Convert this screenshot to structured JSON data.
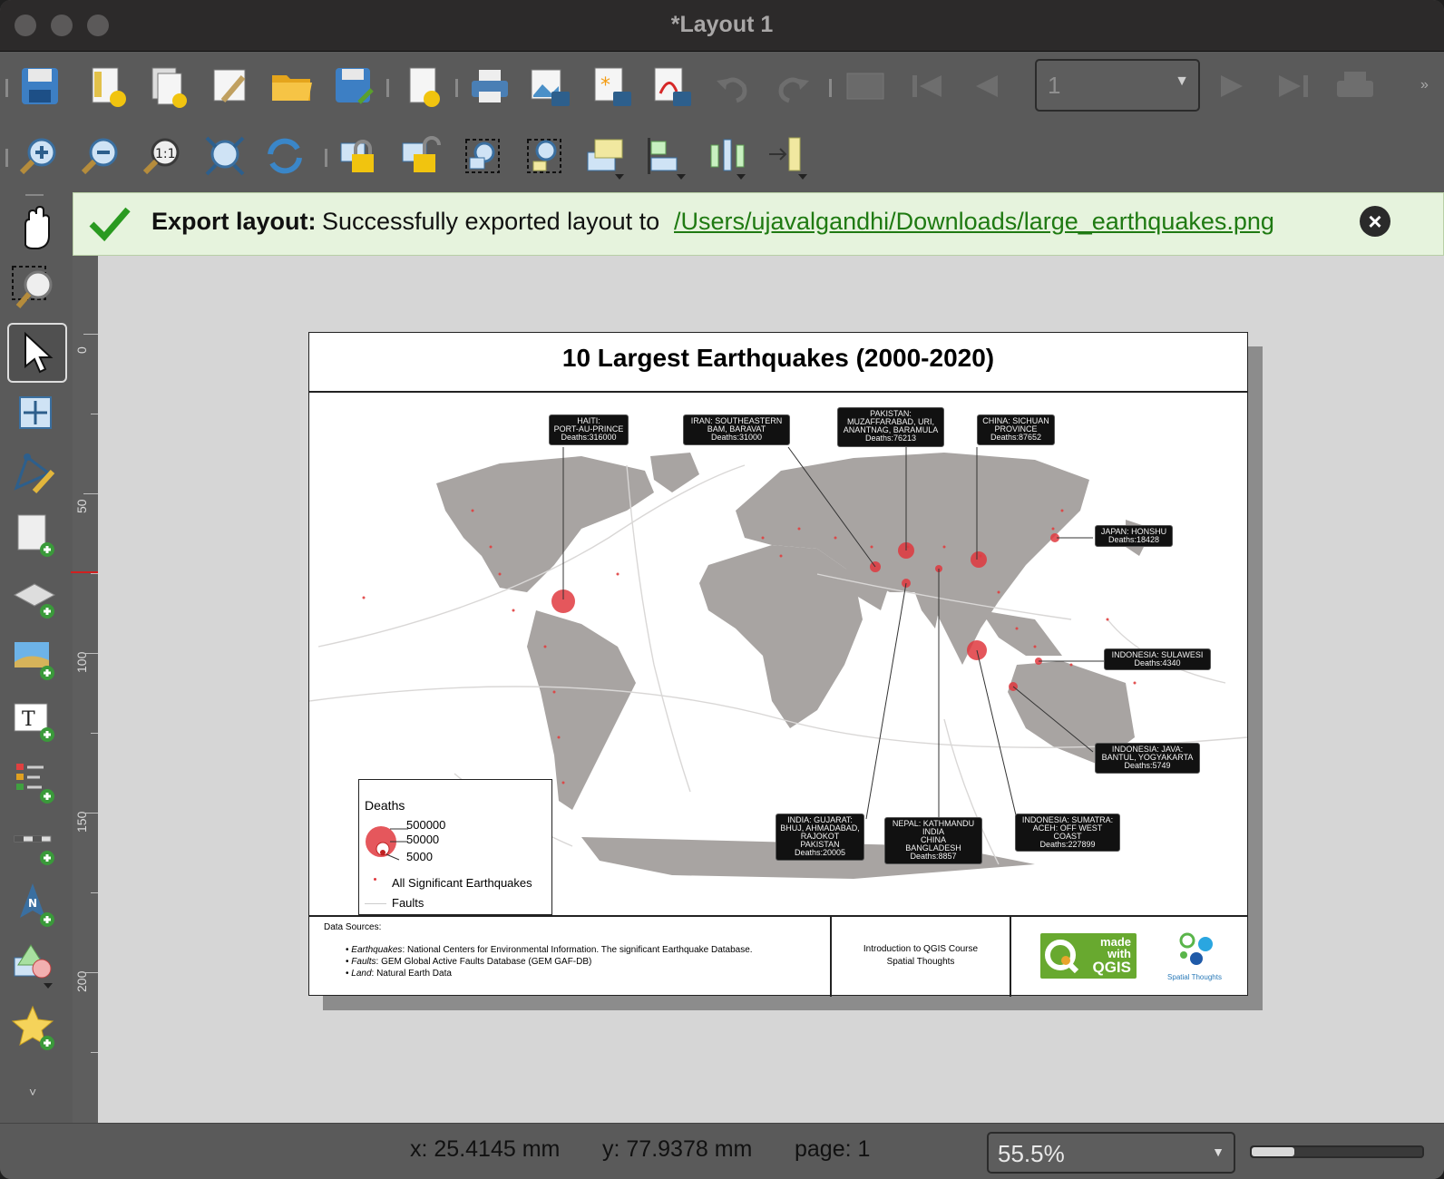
{
  "window": {
    "title": "*Layout 1"
  },
  "toolbar": {
    "row1_icons": [
      "save-icon",
      "new-layout-icon",
      "duplicate-layout-icon",
      "layout-manager-icon",
      "open-folder-icon",
      "save-as-template-icon",
      "add-page-icon",
      "print-icon",
      "export-image-icon",
      "export-svg-icon",
      "export-pdf-icon",
      "undo-icon",
      "redo-icon",
      "atlas-preview-icon",
      "first-feature-icon",
      "previous-feature-icon",
      "next-feature-icon",
      "last-feature-icon",
      "atlas-print-icon"
    ],
    "page_select": {
      "value": "1"
    },
    "row2_icons": [
      "zoom-in-icon",
      "zoom-out-icon",
      "zoom-100-icon",
      "zoom-full-icon",
      "refresh-icon",
      "lock-items-icon",
      "unlock-items-icon",
      "group-items-icon",
      "ungroup-items-icon",
      "raise-items-icon",
      "align-items-icon",
      "distribute-items-icon",
      "resize-items-icon"
    ]
  },
  "left_tools": [
    "pan-icon",
    "zoom-tool-icon",
    "select-move-icon",
    "move-content-icon",
    "edit-nodes-icon",
    "add-map-icon",
    "add-3d-map-icon",
    "add-picture-icon",
    "add-label-icon",
    "add-legend-icon",
    "add-scalebar-icon",
    "add-north-arrow-icon",
    "add-shape-icon",
    "add-marker-icon"
  ],
  "message": {
    "title": "Export layout:",
    "text": "Successfully exported layout to",
    "link": "/Users/ujavalgandhi/Downloads/large_earthquakes.png",
    "color": "#1f7a12"
  },
  "ruler": {
    "labels": [
      "0",
      "50",
      "100",
      "150",
      "200"
    ]
  },
  "layout": {
    "map_title": "10 Largest Earthquakes (2000-2020)",
    "callouts": [
      {
        "id": "haiti",
        "lines": [
          "HAITI:",
          "PORT-AU-PRINCE",
          "Deaths:316000"
        ]
      },
      {
        "id": "iran",
        "lines": [
          "IRAN: SOUTHEASTERN",
          "BAM, BARAVAT",
          "Deaths:31000"
        ]
      },
      {
        "id": "pakistan",
        "lines": [
          "PAKISTAN:",
          "MUZAFFARABAD, URI,",
          "ANANTNAG, BARAMULA",
          "Deaths:76213"
        ]
      },
      {
        "id": "china",
        "lines": [
          "CHINA: SICHUAN",
          "PROVINCE",
          "Deaths:87652"
        ]
      },
      {
        "id": "japan",
        "lines": [
          "JAPAN: HONSHU",
          "Deaths:18428"
        ]
      },
      {
        "id": "sulawesi",
        "lines": [
          "INDONESIA: SULAWESI",
          "Deaths:4340"
        ]
      },
      {
        "id": "java",
        "lines": [
          "INDONESIA: JAVA:",
          "BANTUL, YOGYAKARTA",
          "Deaths:5749"
        ]
      },
      {
        "id": "india",
        "lines": [
          "INDIA: GUJARAT:",
          "BHUJ, AHMADABAD,",
          "RAJOKOT",
          "PAKISTAN",
          "Deaths:20005"
        ]
      },
      {
        "id": "nepal",
        "lines": [
          "NEPAL: KATHMANDU",
          "INDIA",
          "CHINA",
          "BANGLADESH",
          "Deaths:8857"
        ]
      },
      {
        "id": "sumatra",
        "lines": [
          "INDONESIA: SUMATRA:",
          "ACEH: OFF WEST",
          "COAST",
          "Deaths:227899"
        ]
      }
    ],
    "legend": {
      "title": "Deaths",
      "sizes": [
        "500000",
        "50000",
        "5000"
      ],
      "points_label": "All Significant Earthquakes",
      "faults_label": "Faults"
    },
    "footer": {
      "sources_title": "Data Sources:",
      "sources": [
        {
          "name": "Earthquakes",
          "text": ": National Centers for Environmental Information. The significant Earthquake Database."
        },
        {
          "name": "Faults",
          "text": ": GEM Global Active Faults Database (GEM GAF-DB)"
        },
        {
          "name": "Land",
          "text": ": Natural Earth Data"
        }
      ],
      "course_line1": "Introduction to QGIS Course",
      "course_line2": "Spatial Thoughts",
      "qgis_logo_text": [
        "made",
        "with",
        "QGIS"
      ],
      "spatial_logo_text": "Spatial Thoughts"
    }
  },
  "status": {
    "x": "x: 25.4145 mm",
    "y": "y: 77.9378 mm",
    "page": "page: 1",
    "zoom": "55.5%",
    "zoom_fraction": 0.25
  }
}
